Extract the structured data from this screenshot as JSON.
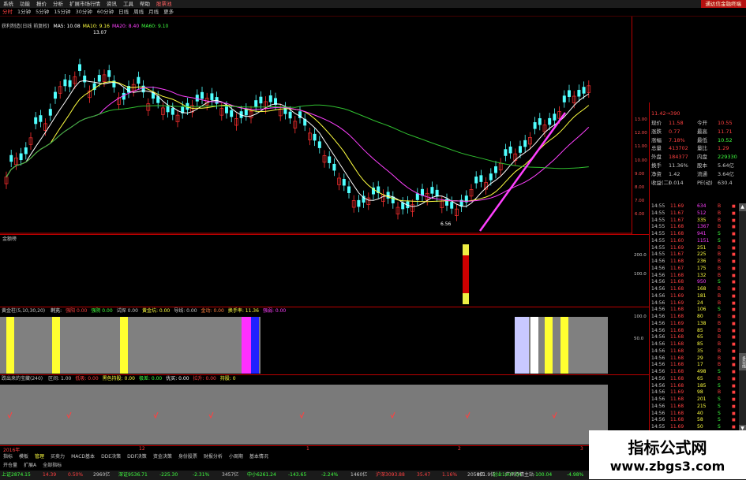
{
  "menubar": {
    "items": [
      "系统",
      "功能",
      "报价",
      "分析",
      "扩展市场行情",
      "资讯",
      "工具",
      "帮助",
      "股票池"
    ],
    "brand": "通达信金融终端"
  },
  "periodbar": {
    "items": [
      "分时",
      "1分钟",
      "5分钟",
      "15分钟",
      "30分钟",
      "60分钟",
      "日线",
      "周线",
      "月线",
      "更多"
    ],
    "active": "日线"
  },
  "main_chart": {
    "indicator_label": "获利制造(日线 前复权)",
    "ma_labels": [
      {
        "text": "MA5: 10.08",
        "color": "#ffffff"
      },
      {
        "text": "MA10: 9.16",
        "color": "#ffff40"
      },
      {
        "text": "MA20: 8.40",
        "color": "#ff40ff"
      },
      {
        "text": "MA60: 9.10",
        "color": "#40ff40"
      }
    ],
    "high_label": "13.07",
    "low_label": "6.56",
    "last_label": "11.42→390"
  },
  "price_axis": [
    "13.00",
    "12.00",
    "11.00",
    "10.00",
    "9.00",
    "8.00",
    "7.00",
    "6.00"
  ],
  "quote": {
    "rows": [
      {
        "l1": "现价",
        "v1": "11.58",
        "l2": "今开",
        "v2": "10.55"
      },
      {
        "l1": "涨跌",
        "v1": "0.77",
        "l2": "最高",
        "v2": "11.71"
      },
      {
        "l1": "涨幅",
        "v1": "7.18%",
        "l2": "最低",
        "v2": "10.52"
      },
      {
        "l1": "总量",
        "v1": "413702",
        "l2": "量比",
        "v2": "1.29"
      },
      {
        "l1": "外盘",
        "v1": "184377",
        "l2": "内盘",
        "v2": "229330"
      },
      {
        "l1": "换手",
        "v1": "11.36%",
        "l2": "股本",
        "v2": "5.64亿"
      },
      {
        "l1": "净资",
        "v1": "1.42",
        "l2": "流通",
        "v2": "3.64亿"
      },
      {
        "l1": "收益(二)",
        "v1": "0.014",
        "l2": "PE(动)",
        "v2": "630.4"
      }
    ]
  },
  "ticks": [
    {
      "t": "14:55",
      "p": "11.69",
      "v": "634",
      "d": "B"
    },
    {
      "t": "14:55",
      "p": "11.67",
      "v": "512",
      "d": "B"
    },
    {
      "t": "14:55",
      "p": "11.67",
      "v": "335",
      "d": "B"
    },
    {
      "t": "14:55",
      "p": "11.68",
      "v": "1367",
      "d": "B"
    },
    {
      "t": "14:55",
      "p": "11.68",
      "v": "941",
      "d": "S"
    },
    {
      "t": "14:55",
      "p": "11.60",
      "v": "1151",
      "d": "S"
    },
    {
      "t": "14:55",
      "p": "11.69",
      "v": "251",
      "d": "B"
    },
    {
      "t": "14:55",
      "p": "11.67",
      "v": "225",
      "d": "B"
    },
    {
      "t": "14:56",
      "p": "11.68",
      "v": "236",
      "d": "B"
    },
    {
      "t": "14:56",
      "p": "11.67",
      "v": "175",
      "d": "B"
    },
    {
      "t": "14:56",
      "p": "11.68",
      "v": "132",
      "d": "B"
    },
    {
      "t": "14:56",
      "p": "11.68",
      "v": "950",
      "d": "S"
    },
    {
      "t": "14:56",
      "p": "11.68",
      "v": "168",
      "d": "B"
    },
    {
      "t": "14:56",
      "p": "11.69",
      "v": "181",
      "d": "B"
    },
    {
      "t": "14:56",
      "p": "11.69",
      "v": "24",
      "d": "B"
    },
    {
      "t": "14:56",
      "p": "11.68",
      "v": "106",
      "d": "S"
    },
    {
      "t": "14:56",
      "p": "11.68",
      "v": "80",
      "d": "B"
    },
    {
      "t": "14:56",
      "p": "11.69",
      "v": "138",
      "d": "B"
    },
    {
      "t": "14:56",
      "p": "11.68",
      "v": "85",
      "d": "B"
    },
    {
      "t": "14:56",
      "p": "11.68",
      "v": "65",
      "d": "B"
    },
    {
      "t": "14:56",
      "p": "11.68",
      "v": "85",
      "d": "B"
    },
    {
      "t": "14:56",
      "p": "11.68",
      "v": "35",
      "d": "B"
    },
    {
      "t": "14:56",
      "p": "11.68",
      "v": "29",
      "d": "B"
    },
    {
      "t": "14:56",
      "p": "11.68",
      "v": "17",
      "d": "B"
    },
    {
      "t": "14:56",
      "p": "11.68",
      "v": "498",
      "d": "S"
    },
    {
      "t": "14:56",
      "p": "11.68",
      "v": "65",
      "d": "B"
    },
    {
      "t": "14:56",
      "p": "11.68",
      "v": "185",
      "d": "S"
    },
    {
      "t": "14:56",
      "p": "11.69",
      "v": "98",
      "d": "B"
    },
    {
      "t": "14:56",
      "p": "11.68",
      "v": "201",
      "d": "S"
    },
    {
      "t": "14:56",
      "p": "11.68",
      "v": "215",
      "d": "S"
    },
    {
      "t": "14:56",
      "p": "11.68",
      "v": "40",
      "d": "S"
    },
    {
      "t": "14:56",
      "p": "11.68",
      "v": "58",
      "d": "S"
    },
    {
      "t": "14:55",
      "p": "11.69",
      "v": "50",
      "d": "S"
    }
  ],
  "panel2": {
    "title": "金额榜",
    "axis": [
      "200.0",
      "100.0"
    ]
  },
  "panel3": {
    "title": "黄金柱(5,10,30,20)",
    "labels": [
      {
        "text": "刺充:",
        "color": "#ffffff"
      },
      {
        "text": "强阳 0.00",
        "color": "#ff4040"
      },
      {
        "text": "强阴 0.00",
        "color": "#40ff40"
      },
      {
        "text": "试探 0.00",
        "color": "#c8c8c8"
      },
      {
        "text": "黄金坑: 0.00",
        "color": "#ffff40"
      },
      {
        "text": "导线: 0.00",
        "color": "#c8c8c8"
      },
      {
        "text": "金动: 0.00",
        "color": "#ff8040"
      },
      {
        "text": "换手率: 11.36",
        "color": "#ffff40"
      },
      {
        "text": "强弱: 0.00",
        "color": "#ff40ff"
      }
    ],
    "axis": [
      "100.0",
      "50.0"
    ]
  },
  "panel4": {
    "title": "跌出来的宝藏(240)",
    "labels": [
      {
        "text": "区间: 1.00",
        "color": "#c8c8c8"
      },
      {
        "text": "低吸: 0.00",
        "color": "#ff4040"
      },
      {
        "text": "黑色持股: 0.00",
        "color": "#ffff40"
      },
      {
        "text": "极差: 0.00",
        "color": "#40ff40"
      },
      {
        "text": "优买: 0.00",
        "color": "#ffffff"
      },
      {
        "text": "拉升: 0.00",
        "color": "#ff4040"
      },
      {
        "text": "持股: 0",
        "color": "#ffff40"
      }
    ]
  },
  "timeline": [
    "2016年",
    "12",
    "1",
    "2",
    "3"
  ],
  "tabs1": [
    "指标",
    "模板",
    "管理",
    "买卖力",
    "MACD基本",
    "DDE决策",
    "DDF决策",
    "资金决策",
    "身份股票",
    "财报分析",
    "小周期",
    "基本情况"
  ],
  "tabs2": [
    "开仓量",
    "扩展A",
    "全部指标"
  ],
  "statusbar": {
    "items": [
      {
        "text": "上证2874.15",
        "color": "#40ff40"
      },
      {
        "text": "14.39",
        "color": "#ff4040"
      },
      {
        "text": "0.50%",
        "color": "#ff4040"
      },
      {
        "text": "2960亿",
        "color": "#c8c8c8"
      },
      {
        "text": "深证9536.71",
        "color": "#40ff40"
      },
      {
        "text": "-225.30",
        "color": "#40ff40"
      },
      {
        "text": "-2.31%",
        "color": "#40ff40"
      },
      {
        "text": "3457亿",
        "color": "#c8c8c8"
      },
      {
        "text": "中小6261.24",
        "color": "#40ff40"
      },
      {
        "text": "-143.65",
        "color": "#40ff40"
      },
      {
        "text": "-2.24%",
        "color": "#40ff40"
      },
      {
        "text": "1460亿",
        "color": "#c8c8c8"
      },
      {
        "text": "沪深3093.88",
        "color": "#ff4040"
      },
      {
        "text": "35.47",
        "color": "#ff4040"
      },
      {
        "text": "1.16%",
        "color": "#ff4040"
      },
      {
        "text": "2050亿",
        "color": "#c8c8c8"
      },
      {
        "text": "创业1907.04",
        "color": "#40ff40"
      },
      {
        "text": "-100.04",
        "color": "#40ff40"
      },
      {
        "text": "-4.98%",
        "color": "#40ff40"
      },
      {
        "text": "801.9亿",
        "color": "#c8c8c8"
      },
      {
        "text": "广州行情主站",
        "color": "#c8c8c8"
      }
    ]
  },
  "watermark": {
    "line1": "指标公式网",
    "line2": "www.zbgs3.com"
  },
  "side_tab": "多日线",
  "colors": {
    "up": "#ff3030",
    "down": "#50ffff",
    "ma5": "#ffffff",
    "ma10": "#ffff40",
    "ma20": "#ff40ff",
    "ma60": "#30c030"
  }
}
